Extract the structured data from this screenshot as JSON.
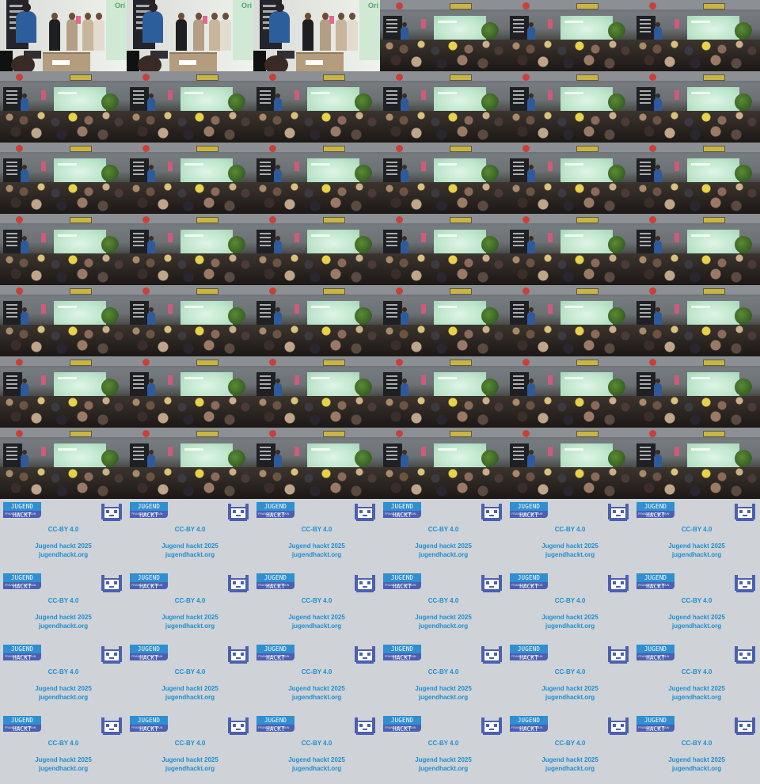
{
  "sheet": {
    "columns": 6,
    "rows": 11,
    "frames": [
      "close",
      "close",
      "close",
      "wide",
      "wide",
      "wide",
      "wide",
      "wide",
      "wide",
      "wide",
      "wide",
      "wide",
      "wide",
      "wide",
      "wide",
      "wide",
      "wide",
      "wide",
      "wide",
      "wide",
      "wide",
      "wide",
      "wide",
      "wide",
      "wide",
      "wide",
      "wide",
      "wide",
      "wide",
      "wide",
      "wide",
      "wide",
      "wide",
      "wide",
      "wide",
      "wide",
      "wide",
      "wide",
      "wide",
      "wide",
      "wide",
      "wide",
      "card",
      "card",
      "card",
      "card",
      "card",
      "card",
      "card",
      "card",
      "card",
      "card",
      "card",
      "card",
      "card",
      "card",
      "card",
      "card",
      "card",
      "card",
      "card",
      "card",
      "card",
      "card",
      "card",
      "card"
    ]
  },
  "close_frame": {
    "green_label": "Ori"
  },
  "card": {
    "logo_text": "JUGEND HACKT",
    "logo_subtext": "FRANKFURT AM MAIN",
    "license": "CC-BY 4.0",
    "event": "Jugend hackt 2025",
    "url": "jugendhackt.org"
  },
  "colors": {
    "card_background": "#cfd2d7",
    "card_text": "#1e8fd0",
    "logo_blue": "#2f8fd0",
    "logo_purple": "#4c5fb0",
    "screen_green": "#cfe9d4"
  }
}
